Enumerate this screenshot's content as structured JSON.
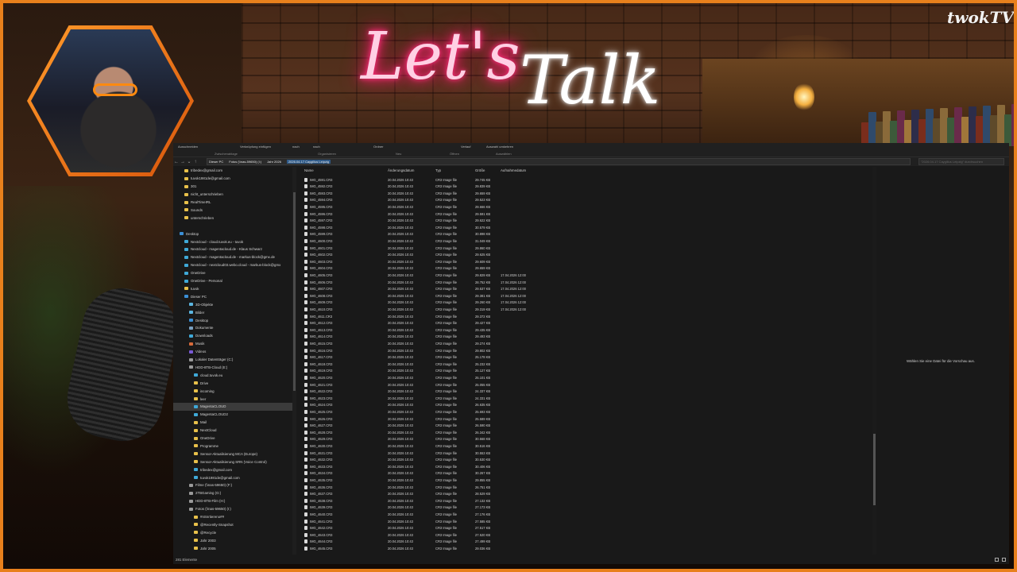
{
  "overlay": {
    "brand": "twokTV",
    "neon_lets": "Let's",
    "neon_talk": "Talk"
  },
  "ribbon": {
    "items": [
      "Ausschneiden",
      "Verknüpfung einfügen",
      "nach",
      "nach",
      "Ordner",
      "Verlauf",
      "Auswahl umkehren"
    ],
    "groups": [
      "Zwischenablage",
      "Organisieren",
      "Neu",
      "Öffnen",
      "Auswählen"
    ]
  },
  "address": {
    "crumbs": [
      "Dieser PC",
      "Fotos (\\\\nas-59650) (I:)",
      "Jahr 2026",
      "2026.04.17 Caygillus Leipzig"
    ],
    "search_placeholder": "\"2026.04.17 Caygillus Leipzig\" durchsuchen"
  },
  "nav": {
    "items": [
      {
        "label": "tribedex@gmail.com",
        "indent": 1,
        "icon": "folder-icon"
      },
      {
        "label": "tuvok1981de@gmail.com",
        "indent": 1,
        "icon": "folder-icon"
      },
      {
        "label": "301",
        "indent": 1,
        "icon": "folder-icon"
      },
      {
        "label": "nicht_unterschrieben",
        "indent": 1,
        "icon": "folder-icon"
      },
      {
        "label": "RealTimeIRL",
        "indent": 1,
        "icon": "folder-icon"
      },
      {
        "label": "Sounds",
        "indent": 1,
        "icon": "folder-icon"
      },
      {
        "label": "unterschrieben",
        "indent": 1,
        "icon": "folder-icon"
      },
      {
        "label": "",
        "indent": 0,
        "icon": ""
      },
      {
        "label": "Desktop",
        "indent": 0,
        "icon": "desktop-icon"
      },
      {
        "label": "Nextcloud - cloud.tuvok.eu - tuvok",
        "indent": 1,
        "icon": "cloud-icon"
      },
      {
        "label": "Nextcloud - magentacloud.de - Klaus Schwarz",
        "indent": 1,
        "icon": "cloud-icon"
      },
      {
        "label": "Nextcloud - magentacloud.de - markus-block@gmx.de",
        "indent": 1,
        "icon": "cloud-icon"
      },
      {
        "label": "Nextcloud - nextcloud03.webo.cloud - markus-block@gmx",
        "indent": 1,
        "icon": "cloud-icon"
      },
      {
        "label": "OneDrive",
        "indent": 1,
        "icon": "cloud-icon"
      },
      {
        "label": "OneDrive - Personal",
        "indent": 1,
        "icon": "cloud-icon"
      },
      {
        "label": "tuvok",
        "indent": 1,
        "icon": "user-icon"
      },
      {
        "label": "Dieser PC",
        "indent": 1,
        "icon": "pc-icon"
      },
      {
        "label": "3D-Objekte",
        "indent": 2,
        "icon": "cube-icon"
      },
      {
        "label": "Bilder",
        "indent": 2,
        "icon": "image-icon"
      },
      {
        "label": "Desktop",
        "indent": 2,
        "icon": "desktop-icon"
      },
      {
        "label": "Dokumente",
        "indent": 2,
        "icon": "document-icon"
      },
      {
        "label": "Downloads",
        "indent": 2,
        "icon": "download-icon"
      },
      {
        "label": "Musik",
        "indent": 2,
        "icon": "music-icon"
      },
      {
        "label": "Videos",
        "indent": 2,
        "icon": "video-icon"
      },
      {
        "label": "Lokaler Datenträger (C:)",
        "indent": 2,
        "icon": "drive-icon"
      },
      {
        "label": "HDD-8TB-Cloud (E:)",
        "indent": 2,
        "icon": "drive-icon"
      },
      {
        "label": "cloud.tuvok.eu",
        "indent": 3,
        "icon": "cloud-icon"
      },
      {
        "label": "Drive",
        "indent": 3,
        "icon": "folder-icon"
      },
      {
        "label": "incoming",
        "indent": 3,
        "icon": "folder-icon"
      },
      {
        "label": "leer",
        "indent": 3,
        "icon": "folder-icon"
      },
      {
        "label": "MagentaCLOUD",
        "indent": 3,
        "icon": "cloud-icon",
        "highlight": true
      },
      {
        "label": "MagentaCLOUD2",
        "indent": 3,
        "icon": "cloud-icon"
      },
      {
        "label": "Mail",
        "indent": 3,
        "icon": "folder-icon"
      },
      {
        "label": "NextCloud",
        "indent": 3,
        "icon": "folder-icon"
      },
      {
        "label": "OneDrive",
        "indent": 3,
        "icon": "folder-icon"
      },
      {
        "label": "Programme",
        "indent": 3,
        "icon": "folder-icon"
      },
      {
        "label": "Sensor-Aktualisierung MCA (Europe)",
        "indent": 3,
        "icon": "folder-icon"
      },
      {
        "label": "Sensor-Aktualisierung SRN (Voice Control)",
        "indent": 3,
        "icon": "folder-icon"
      },
      {
        "label": "tribedex@gmail.com",
        "indent": 3,
        "icon": "cloud-icon"
      },
      {
        "label": "tuvok1981de@gmail.com",
        "indent": 3,
        "icon": "cloud-icon"
      },
      {
        "label": "Filme (\\\\nas-59650) (F:)",
        "indent": 2,
        "icon": "drive-icon"
      },
      {
        "label": "2TBGaming (G:)",
        "indent": 2,
        "icon": "drive-icon"
      },
      {
        "label": "HDD-8TB-Film (H:)",
        "indent": 2,
        "icon": "drive-icon"
      },
      {
        "label": "Fotos (\\\\nas-59650) (I:)",
        "indent": 2,
        "icon": "drive-icon"
      },
      {
        "label": "#nSnrtiereno##",
        "indent": 3,
        "icon": "folder-icon"
      },
      {
        "label": "@Recently-Snapshot",
        "indent": 3,
        "icon": "folder-icon"
      },
      {
        "label": "@Recycle",
        "indent": 3,
        "icon": "folder-icon"
      },
      {
        "label": "Jahr 2003",
        "indent": 3,
        "icon": "folder-icon"
      },
      {
        "label": "Jahr 2005",
        "indent": 3,
        "icon": "folder-icon"
      },
      {
        "label": "Jahr 2008",
        "indent": 3,
        "icon": "folder-icon"
      }
    ]
  },
  "columns": [
    "Name",
    "Änderungsdatum",
    "Typ",
    "Größe",
    "Aufnahmedatum"
  ],
  "files": [
    [
      "IMG_4591.CR3",
      "20.04.2026 10:43",
      "CR3 Image file",
      "29.745 KB",
      ""
    ],
    [
      "IMG_4592.CR3",
      "20.04.2026 10:43",
      "CR3 Image file",
      "29.839 KB",
      ""
    ],
    [
      "IMG_4593.CR3",
      "20.04.2026 10:43",
      "CR3 Image file",
      "29.659 KB",
      ""
    ],
    [
      "IMG_4594.CR3",
      "20.04.2026 10:43",
      "CR3 Image file",
      "29.523 KB",
      ""
    ],
    [
      "IMG_4595.CR3",
      "20.04.2026 10:43",
      "CR3 Image file",
      "29.666 KB",
      ""
    ],
    [
      "IMG_4596.CR3",
      "20.04.2026 10:43",
      "CR3 Image file",
      "29.591 KB",
      ""
    ],
    [
      "IMG_4597.CR3",
      "20.04.2026 10:43",
      "CR3 Image file",
      "29.622 KB",
      ""
    ],
    [
      "IMG_4598.CR3",
      "20.04.2026 10:43",
      "CR3 Image file",
      "30.579 KB",
      ""
    ],
    [
      "IMG_4599.CR3",
      "20.04.2026 10:43",
      "CR3 Image file",
      "30.898 KB",
      ""
    ],
    [
      "IMG_4600.CR3",
      "20.04.2026 10:43",
      "CR3 Image file",
      "31.049 KB",
      ""
    ],
    [
      "IMG_4601.CR3",
      "20.04.2026 10:43",
      "CR3 Image file",
      "29.860 KB",
      ""
    ],
    [
      "IMG_4602.CR3",
      "20.04.2026 10:43",
      "CR3 Image file",
      "29.625 KB",
      ""
    ],
    [
      "IMG_4603.CR3",
      "20.04.2026 10:43",
      "CR3 Image file",
      "29.609 KB",
      ""
    ],
    [
      "IMG_4604.CR3",
      "20.04.2026 10:43",
      "CR3 Image file",
      "29.659 KB",
      ""
    ],
    [
      "IMG_4605.CR3",
      "20.04.2026 10:43",
      "CR3 Image file",
      "29.829 KB",
      "17.04.2026 12:00"
    ],
    [
      "IMG_4606.CR3",
      "20.04.2026 10:43",
      "CR3 Image file",
      "28.752 KB",
      "17.04.2026 12:00"
    ],
    [
      "IMG_4607.CR3",
      "20.04.2026 10:43",
      "CR3 Image file",
      "29.537 KB",
      "17.04.2026 12:00"
    ],
    [
      "IMG_4608.CR3",
      "20.04.2026 10:43",
      "CR3 Image file",
      "29.381 KB",
      "17.04.2026 12:00"
    ],
    [
      "IMG_4609.CR3",
      "20.04.2026 10:43",
      "CR3 Image file",
      "29.260 KB",
      "17.04.2026 12:00"
    ],
    [
      "IMG_4610.CR3",
      "20.04.2026 10:43",
      "CR3 Image file",
      "29.319 KB",
      "17.04.2026 12:00"
    ],
    [
      "IMG_4611.CR3",
      "20.04.2026 10:43",
      "CR3 Image file",
      "29.372 KB",
      ""
    ],
    [
      "IMG_4612.CR3",
      "20.04.2026 10:43",
      "CR3 Image file",
      "29.427 KB",
      ""
    ],
    [
      "IMG_4613.CR3",
      "20.04.2026 10:43",
      "CR3 Image file",
      "29.435 KB",
      ""
    ],
    [
      "IMG_4614.CR3",
      "20.04.2026 10:43",
      "CR3 Image file",
      "29.493 KB",
      ""
    ],
    [
      "IMG_4615.CR3",
      "20.04.2026 10:43",
      "CR3 Image file",
      "29.274 KB",
      ""
    ],
    [
      "IMG_4616.CR3",
      "20.04.2026 10:43",
      "CR3 Image file",
      "29.802 KB",
      ""
    ],
    [
      "IMG_4617.CR3",
      "20.04.2026 10:43",
      "CR3 Image file",
      "25.178 KB",
      ""
    ],
    [
      "IMG_4618.CR3",
      "20.04.2026 10:43",
      "CR3 Image file",
      "25.232 KB",
      ""
    ],
    [
      "IMG_4619.CR3",
      "20.04.2026 10:43",
      "CR3 Image file",
      "25.127 KB",
      ""
    ],
    [
      "IMG_4620.CR3",
      "20.04.2026 10:43",
      "CR3 Image file",
      "25.101 KB",
      ""
    ],
    [
      "IMG_4621.CR3",
      "20.04.2026 10:43",
      "CR3 Image file",
      "25.055 KB",
      ""
    ],
    [
      "IMG_4622.CR3",
      "20.04.2026 10:43",
      "CR3 Image file",
      "24.337 KB",
      ""
    ],
    [
      "IMG_4623.CR3",
      "20.04.2026 10:43",
      "CR3 Image file",
      "24.331 KB",
      ""
    ],
    [
      "IMG_4624.CR3",
      "20.04.2026 10:43",
      "CR3 Image file",
      "26.635 KB",
      ""
    ],
    [
      "IMG_4625.CR3",
      "20.04.2026 10:43",
      "CR3 Image file",
      "25.693 KB",
      ""
    ],
    [
      "IMG_4626.CR3",
      "20.04.2026 10:43",
      "CR3 Image file",
      "25.589 KB",
      ""
    ],
    [
      "IMG_4627.CR3",
      "20.04.2026 10:43",
      "CR3 Image file",
      "26.590 KB",
      ""
    ],
    [
      "IMG_4628.CR3",
      "20.04.2026 10:43",
      "CR3 Image file",
      "26.342 KB",
      ""
    ],
    [
      "IMG_4629.CR3",
      "20.04.2026 10:43",
      "CR3 Image file",
      "30.568 KB",
      ""
    ],
    [
      "IMG_4630.CR3",
      "20.04.2026 10:43",
      "CR3 Image file",
      "30.516 KB",
      ""
    ],
    [
      "IMG_4631.CR3",
      "20.04.2026 10:43",
      "CR3 Image file",
      "30.553 KB",
      ""
    ],
    [
      "IMG_4632.CR3",
      "20.04.2026 10:43",
      "CR3 Image file",
      "30.530 KB",
      ""
    ],
    [
      "IMG_4633.CR3",
      "20.04.2026 10:43",
      "CR3 Image file",
      "30.406 KB",
      ""
    ],
    [
      "IMG_4634.CR3",
      "20.04.2026 10:43",
      "CR3 Image file",
      "30.267 KB",
      ""
    ],
    [
      "IMG_4635.CR3",
      "20.04.2026 10:43",
      "CR3 Image file",
      "29.855 KB",
      ""
    ],
    [
      "IMG_4636.CR3",
      "20.04.2026 10:43",
      "CR3 Image file",
      "26.751 KB",
      ""
    ],
    [
      "IMG_4637.CR3",
      "20.04.2026 10:43",
      "CR3 Image file",
      "28.529 KB",
      ""
    ],
    [
      "IMG_4638.CR3",
      "20.04.2026 10:43",
      "CR3 Image file",
      "27.132 KB",
      ""
    ],
    [
      "IMG_4639.CR3",
      "20.04.2026 10:43",
      "CR3 Image file",
      "27.173 KB",
      ""
    ],
    [
      "IMG_4640.CR3",
      "20.04.2026 10:43",
      "CR3 Image file",
      "27.176 KB",
      ""
    ],
    [
      "IMG_4641.CR3",
      "20.04.2026 10:43",
      "CR3 Image file",
      "27.585 KB",
      ""
    ],
    [
      "IMG_4642.CR3",
      "20.04.2026 10:43",
      "CR3 Image file",
      "27.517 KB",
      ""
    ],
    [
      "IMG_4643.CR3",
      "20.04.2026 10:43",
      "CR3 Image file",
      "27.520 KB",
      ""
    ],
    [
      "IMG_4644.CR3",
      "20.04.2026 10:43",
      "CR3 Image file",
      "27.499 KB",
      ""
    ],
    [
      "IMG_4645.CR3",
      "20.04.2026 10:43",
      "CR3 Image file",
      "29.036 KB",
      ""
    ]
  ],
  "preview_text": "Wählen Sie eine Datei für die Vorschau aus.",
  "status": "281 Elemente",
  "colors": {
    "accent": "#e8801c",
    "neon_pink": "#ff2d7a",
    "selection": "#2f5a88"
  }
}
